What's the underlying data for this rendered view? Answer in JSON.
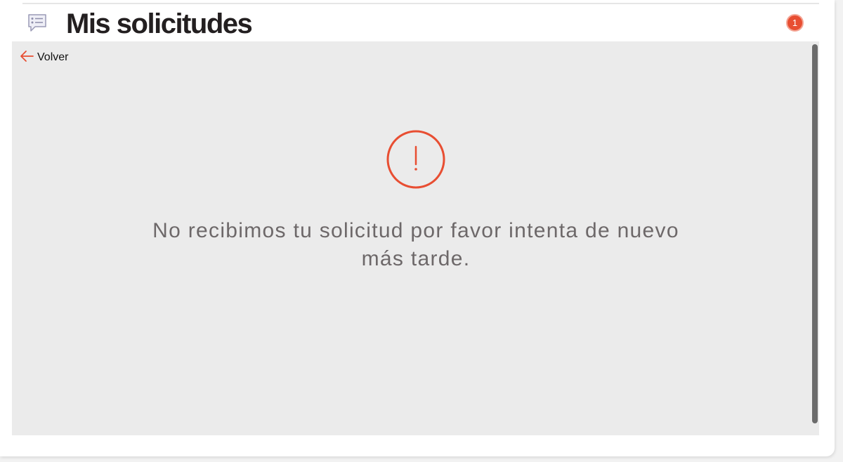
{
  "header": {
    "title": "Mis solicitudes",
    "notification_count": "1",
    "icon": "request-list-icon"
  },
  "content": {
    "back_label": "Volver",
    "back_icon": "arrow-left-icon",
    "error_icon": "exclamation-circle-icon",
    "error_message": "No recibimos tu solicitud por favor intenta de nuevo más tarde."
  },
  "colors": {
    "accent": "#e84e32",
    "title": "#231f20",
    "message": "#6d6869",
    "panel": "#ebebeb"
  }
}
